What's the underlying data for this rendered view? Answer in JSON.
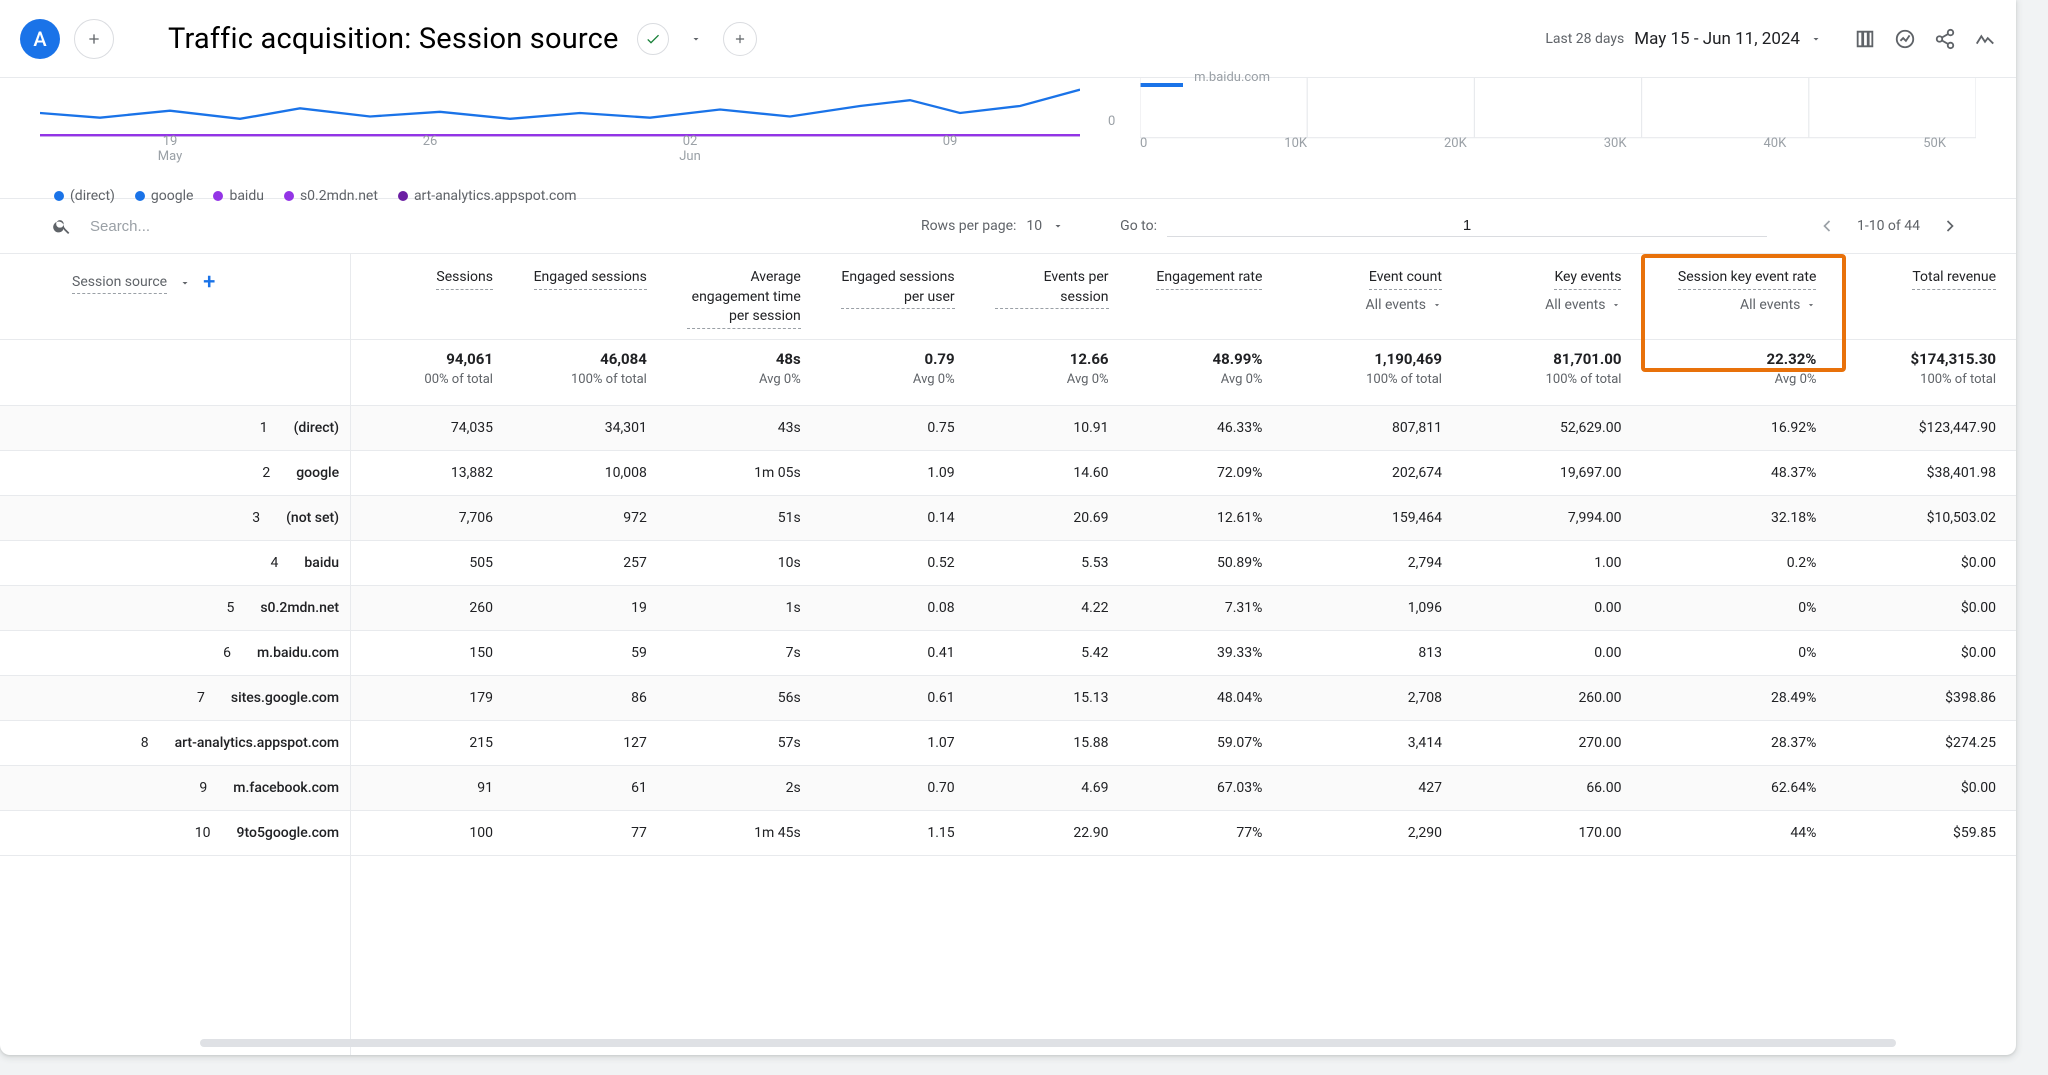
{
  "header": {
    "avatar_letter": "A",
    "title": "Traffic acquisition: Session source",
    "range_label": "Last 28 days",
    "range_value": "May 15 - Jun 11, 2024"
  },
  "chart": {
    "zero": "0",
    "ticks": [
      {
        "top": "19",
        "bot": "May"
      },
      {
        "top": "26",
        "bot": ""
      },
      {
        "top": "02",
        "bot": "Jun"
      },
      {
        "top": "09",
        "bot": ""
      }
    ],
    "legend": [
      {
        "label": "(direct)",
        "color": "#1a73e8"
      },
      {
        "label": "google",
        "color": "#1a73e8"
      },
      {
        "label": "baidu",
        "color": "#9334e6"
      },
      {
        "label": "s0.2mdn.net",
        "color": "#9334e6"
      },
      {
        "label": "art-analytics.appspot.com",
        "color": "#6b1fa3"
      }
    ],
    "right_label": "m.baidu.com",
    "right_ticks": [
      "0",
      "10K",
      "20K",
      "30K",
      "40K",
      "50K"
    ]
  },
  "toolbar": {
    "search_placeholder": "Search...",
    "rpp_label": "Rows per page:",
    "rpp_value": "10",
    "goto_label": "Go to:",
    "goto_value": "1",
    "range": "1-10 of 44"
  },
  "columns": {
    "dimension_label": "Session source",
    "metrics": [
      {
        "k": "sessions",
        "label": "Sessions"
      },
      {
        "k": "engaged",
        "label": "Engaged sessions"
      },
      {
        "k": "avg_eng",
        "label": "Average engagement time per session"
      },
      {
        "k": "eng_per_user",
        "label": "Engaged sessions per user"
      },
      {
        "k": "events_per",
        "label": "Events per session"
      },
      {
        "k": "eng_rate",
        "label": "Engagement rate"
      },
      {
        "k": "event_count",
        "label": "Event count",
        "sub": "All events"
      },
      {
        "k": "key_events",
        "label": "Key events",
        "sub": "All events"
      },
      {
        "k": "sess_key_rate",
        "label": "Session key event rate",
        "sub": "All events"
      },
      {
        "k": "revenue",
        "label": "Total revenue"
      }
    ]
  },
  "totals": {
    "sessions": {
      "v": "94,061",
      "s": "00% of total"
    },
    "engaged": {
      "v": "46,084",
      "s": "100% of total"
    },
    "avg_eng": {
      "v": "48s",
      "s": "Avg 0%"
    },
    "eng_per_user": {
      "v": "0.79",
      "s": "Avg 0%"
    },
    "events_per": {
      "v": "12.66",
      "s": "Avg 0%"
    },
    "eng_rate": {
      "v": "48.99%",
      "s": "Avg 0%"
    },
    "event_count": {
      "v": "1,190,469",
      "s": "100% of total"
    },
    "key_events": {
      "v": "81,701.00",
      "s": "100% of total"
    },
    "sess_key_rate": {
      "v": "22.32%",
      "s": "Avg 0%"
    },
    "revenue": {
      "v": "$174,315.30",
      "s": "100% of total"
    }
  },
  "rows": [
    {
      "n": "1",
      "src": "(direct)",
      "sessions": "74,035",
      "engaged": "34,301",
      "avg_eng": "43s",
      "eng_per_user": "0.75",
      "events_per": "10.91",
      "eng_rate": "46.33%",
      "event_count": "807,811",
      "key_events": "52,629.00",
      "sess_key_rate": "16.92%",
      "revenue": "$123,447.90"
    },
    {
      "n": "2",
      "src": "google",
      "sessions": "13,882",
      "engaged": "10,008",
      "avg_eng": "1m 05s",
      "eng_per_user": "1.09",
      "events_per": "14.60",
      "eng_rate": "72.09%",
      "event_count": "202,674",
      "key_events": "19,697.00",
      "sess_key_rate": "48.37%",
      "revenue": "$38,401.98"
    },
    {
      "n": "3",
      "src": "(not set)",
      "sessions": "7,706",
      "engaged": "972",
      "avg_eng": "51s",
      "eng_per_user": "0.14",
      "events_per": "20.69",
      "eng_rate": "12.61%",
      "event_count": "159,464",
      "key_events": "7,994.00",
      "sess_key_rate": "32.18%",
      "revenue": "$10,503.02"
    },
    {
      "n": "4",
      "src": "baidu",
      "sessions": "505",
      "engaged": "257",
      "avg_eng": "10s",
      "eng_per_user": "0.52",
      "events_per": "5.53",
      "eng_rate": "50.89%",
      "event_count": "2,794",
      "key_events": "1.00",
      "sess_key_rate": "0.2%",
      "revenue": "$0.00"
    },
    {
      "n": "5",
      "src": "s0.2mdn.net",
      "sessions": "260",
      "engaged": "19",
      "avg_eng": "1s",
      "eng_per_user": "0.08",
      "events_per": "4.22",
      "eng_rate": "7.31%",
      "event_count": "1,096",
      "key_events": "0.00",
      "sess_key_rate": "0%",
      "revenue": "$0.00"
    },
    {
      "n": "6",
      "src": "m.baidu.com",
      "sessions": "150",
      "engaged": "59",
      "avg_eng": "7s",
      "eng_per_user": "0.41",
      "events_per": "5.42",
      "eng_rate": "39.33%",
      "event_count": "813",
      "key_events": "0.00",
      "sess_key_rate": "0%",
      "revenue": "$0.00"
    },
    {
      "n": "7",
      "src": "sites.google.com",
      "sessions": "179",
      "engaged": "86",
      "avg_eng": "56s",
      "eng_per_user": "0.61",
      "events_per": "15.13",
      "eng_rate": "48.04%",
      "event_count": "2,708",
      "key_events": "260.00",
      "sess_key_rate": "28.49%",
      "revenue": "$398.86"
    },
    {
      "n": "8",
      "src": "art-analytics.appspot.com",
      "sessions": "215",
      "engaged": "127",
      "avg_eng": "57s",
      "eng_per_user": "1.07",
      "events_per": "15.88",
      "eng_rate": "59.07%",
      "event_count": "3,414",
      "key_events": "270.00",
      "sess_key_rate": "28.37%",
      "revenue": "$274.25"
    },
    {
      "n": "9",
      "src": "m.facebook.com",
      "sessions": "91",
      "engaged": "61",
      "avg_eng": "2s",
      "eng_per_user": "0.70",
      "events_per": "4.69",
      "eng_rate": "67.03%",
      "event_count": "427",
      "key_events": "66.00",
      "sess_key_rate": "62.64%",
      "revenue": "$0.00"
    },
    {
      "n": "10",
      "src": "9to5google.com",
      "sessions": "100",
      "engaged": "77",
      "avg_eng": "1m 45s",
      "eng_per_user": "1.15",
      "events_per": "22.90",
      "eng_rate": "77%",
      "event_count": "2,290",
      "key_events": "170.00",
      "sess_key_rate": "44%",
      "revenue": "$59.85"
    }
  ]
}
